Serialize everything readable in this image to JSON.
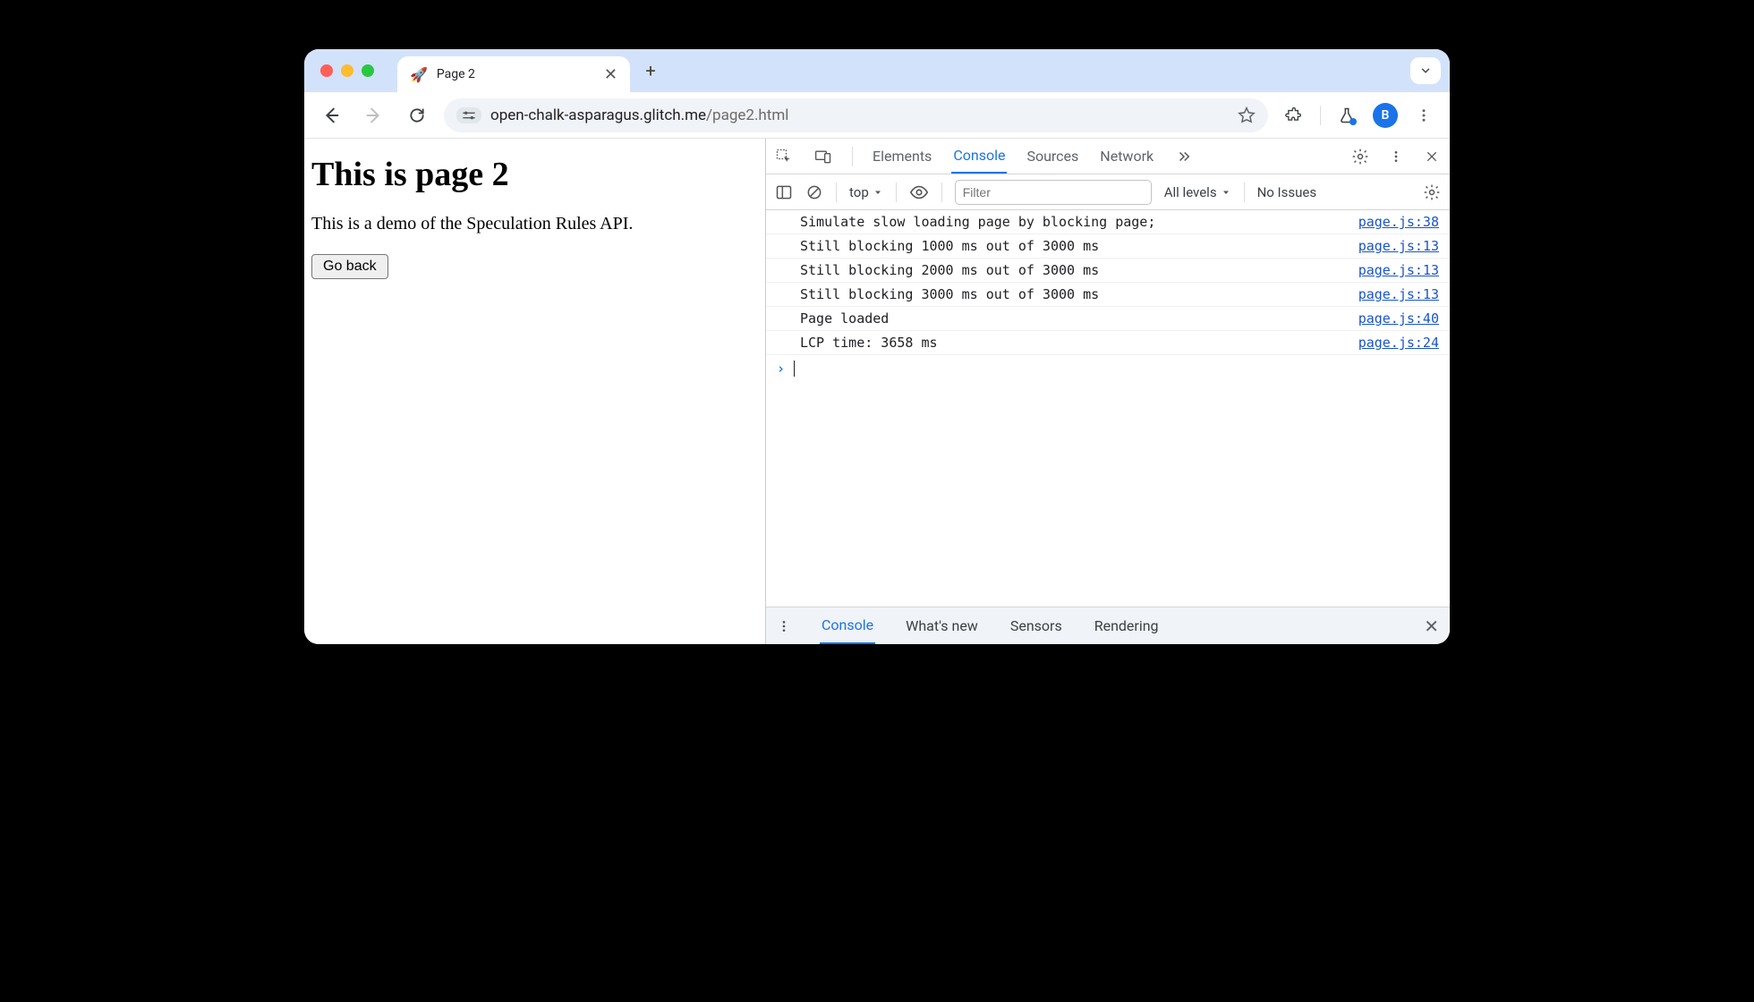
{
  "window": {
    "tab_favicon": "🚀",
    "tab_title": "Page 2"
  },
  "toolbar": {
    "url_host": "open-chalk-asparagus.glitch.me",
    "url_path": "/page2.html",
    "avatar_initial": "B"
  },
  "page": {
    "heading": "This is page 2",
    "paragraph": "This is a demo of the Speculation Rules API.",
    "button_label": "Go back"
  },
  "devtools": {
    "tabs": [
      "Elements",
      "Console",
      "Sources",
      "Network"
    ],
    "active_tab": "Console",
    "context": "top",
    "filter_placeholder": "Filter",
    "levels_label": "All levels",
    "issues_label": "No Issues",
    "logs": [
      {
        "msg": "Simulate slow loading page by blocking page;",
        "src": "page.js:38"
      },
      {
        "msg": "Still blocking 1000 ms out of 3000 ms",
        "src": "page.js:13"
      },
      {
        "msg": "Still blocking 2000 ms out of 3000 ms",
        "src": "page.js:13"
      },
      {
        "msg": "Still blocking 3000 ms out of 3000 ms",
        "src": "page.js:13"
      },
      {
        "msg": "Page loaded",
        "src": "page.js:40"
      },
      {
        "msg": "LCP time: 3658 ms",
        "src": "page.js:24"
      }
    ],
    "drawer_tabs": [
      "Console",
      "What's new",
      "Sensors",
      "Rendering"
    ],
    "drawer_active": "Console"
  }
}
